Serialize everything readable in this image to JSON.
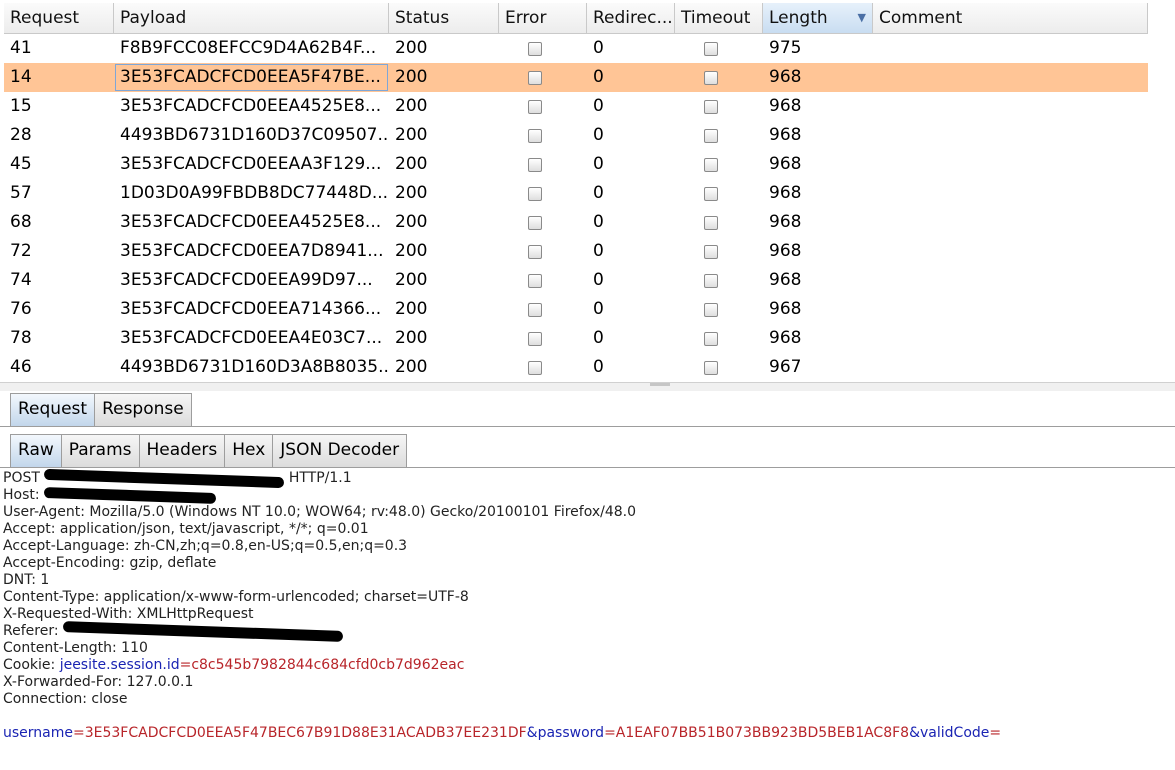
{
  "table": {
    "columns": [
      {
        "label": "Request"
      },
      {
        "label": "Payload"
      },
      {
        "label": "Status"
      },
      {
        "label": "Error"
      },
      {
        "label": "Redirec..."
      },
      {
        "label": "Timeout"
      },
      {
        "label": "Length",
        "sorted": "descending"
      },
      {
        "label": "Comment"
      }
    ],
    "rows": [
      {
        "request": "41",
        "payload": "F8B9FCC08EFCC9D4A62B4F...",
        "status": "200",
        "redirect": "0",
        "length": "975",
        "error": false,
        "timeout": false,
        "selected": false
      },
      {
        "request": "14",
        "payload": "3E53FCADCFCD0EEA5F47BE...",
        "status": "200",
        "redirect": "0",
        "length": "968",
        "error": false,
        "timeout": false,
        "selected": true
      },
      {
        "request": "15",
        "payload": "3E53FCADCFCD0EEA4525E8...",
        "status": "200",
        "redirect": "0",
        "length": "968",
        "error": false,
        "timeout": false,
        "selected": false
      },
      {
        "request": "28",
        "payload": "4493BD6731D160D37C09507...",
        "status": "200",
        "redirect": "0",
        "length": "968",
        "error": false,
        "timeout": false,
        "selected": false
      },
      {
        "request": "45",
        "payload": "3E53FCADCFCD0EEAA3F129...",
        "status": "200",
        "redirect": "0",
        "length": "968",
        "error": false,
        "timeout": false,
        "selected": false
      },
      {
        "request": "57",
        "payload": "1D03D0A99FBDB8DC77448D...",
        "status": "200",
        "redirect": "0",
        "length": "968",
        "error": false,
        "timeout": false,
        "selected": false
      },
      {
        "request": "68",
        "payload": "3E53FCADCFCD0EEA4525E8...",
        "status": "200",
        "redirect": "0",
        "length": "968",
        "error": false,
        "timeout": false,
        "selected": false
      },
      {
        "request": "72",
        "payload": "3E53FCADCFCD0EEA7D8941...",
        "status": "200",
        "redirect": "0",
        "length": "968",
        "error": false,
        "timeout": false,
        "selected": false
      },
      {
        "request": "74",
        "payload": "3E53FCADCFCD0EEA99D97...",
        "status": "200",
        "redirect": "0",
        "length": "968",
        "error": false,
        "timeout": false,
        "selected": false
      },
      {
        "request": "76",
        "payload": "3E53FCADCFCD0EEA714366...",
        "status": "200",
        "redirect": "0",
        "length": "968",
        "error": false,
        "timeout": false,
        "selected": false
      },
      {
        "request": "78",
        "payload": "3E53FCADCFCD0EEA4E03C7...",
        "status": "200",
        "redirect": "0",
        "length": "968",
        "error": false,
        "timeout": false,
        "selected": false
      },
      {
        "request": "46",
        "payload": "4493BD6731D160D3A8B8035...",
        "status": "200",
        "redirect": "0",
        "length": "967",
        "error": false,
        "timeout": false,
        "selected": false
      }
    ],
    "selected_row_color": "#ffc596"
  },
  "tabs_outer": {
    "request": "Request",
    "response": "Response",
    "active": "request"
  },
  "tabs_inner": {
    "raw": "Raw",
    "params": "Params",
    "headers": "Headers",
    "hex": "Hex",
    "json_decoder": "JSON Decoder",
    "active": "raw"
  },
  "raw_request": {
    "request_line_method": "POST",
    "request_line_version": "HTTP/1.1",
    "host_label": "Host:",
    "user_agent": "User-Agent: Mozilla/5.0 (Windows NT 10.0; WOW64; rv:48.0) Gecko/20100101 Firefox/48.0",
    "accept": "Accept: application/json, text/javascript, */*; q=0.01",
    "accept_language": "Accept-Language: zh-CN,zh;q=0.8,en-US;q=0.5,en;q=0.3",
    "accept_encoding": "Accept-Encoding: gzip, deflate",
    "dnt": "DNT: 1",
    "content_type": "Content-Type: application/x-www-form-urlencoded; charset=UTF-8",
    "x_requested_with": "X-Requested-With: XMLHttpRequest",
    "referer_label": "Referer:",
    "content_length": "Content-Length: 110",
    "cookie_label": "Cookie: ",
    "cookie_name": "jeesite.session.id",
    "cookie_eq": "=",
    "cookie_value": "c8c545b7982844c684cfd0cb7d962eac",
    "x_forwarded_for": "X-Forwarded-For: 127.0.0.1",
    "connection": "Connection: close",
    "body": {
      "username_name": "username",
      "username_value": "3E53FCADCFCD0EEA5F47BEC67B91D88E31ACADB37EE231DF",
      "password_name": "password",
      "password_value": "A1EAF07BB51B073BB923BD5BEB1AC8F8",
      "validcode_name": "validCode",
      "eq": "=",
      "amp": "&"
    }
  },
  "colors": {
    "param_name": "#1a24b3",
    "param_value": "#b8252a",
    "active_tab": "#c2d6eb"
  }
}
